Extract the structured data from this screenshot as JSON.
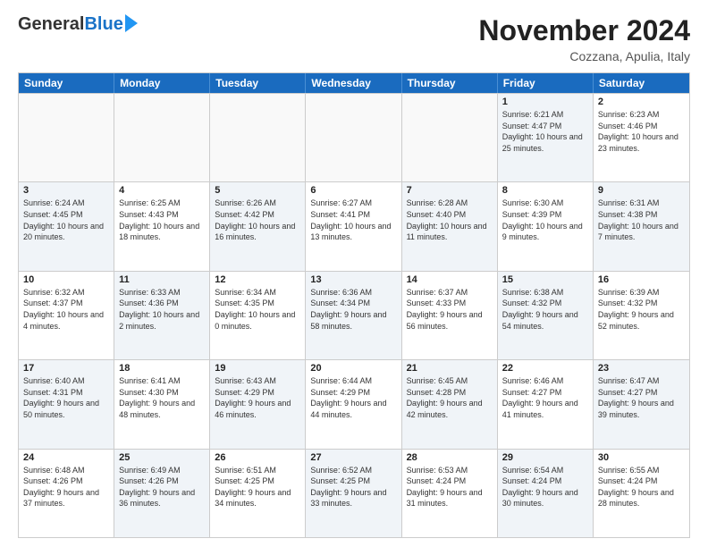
{
  "logo": {
    "general": "General",
    "blue": "Blue"
  },
  "title": "November 2024",
  "location": "Cozzana, Apulia, Italy",
  "weekdays": [
    "Sunday",
    "Monday",
    "Tuesday",
    "Wednesday",
    "Thursday",
    "Friday",
    "Saturday"
  ],
  "rows": [
    [
      {
        "day": "",
        "text": "",
        "empty": true
      },
      {
        "day": "",
        "text": "",
        "empty": true
      },
      {
        "day": "",
        "text": "",
        "empty": true
      },
      {
        "day": "",
        "text": "",
        "empty": true
      },
      {
        "day": "",
        "text": "",
        "empty": true
      },
      {
        "day": "1",
        "text": "Sunrise: 6:21 AM\nSunset: 4:47 PM\nDaylight: 10 hours and 25 minutes.",
        "shaded": true
      },
      {
        "day": "2",
        "text": "Sunrise: 6:23 AM\nSunset: 4:46 PM\nDaylight: 10 hours and 23 minutes.",
        "shaded": false
      }
    ],
    [
      {
        "day": "3",
        "text": "Sunrise: 6:24 AM\nSunset: 4:45 PM\nDaylight: 10 hours and 20 minutes.",
        "shaded": true
      },
      {
        "day": "4",
        "text": "Sunrise: 6:25 AM\nSunset: 4:43 PM\nDaylight: 10 hours and 18 minutes.",
        "shaded": false
      },
      {
        "day": "5",
        "text": "Sunrise: 6:26 AM\nSunset: 4:42 PM\nDaylight: 10 hours and 16 minutes.",
        "shaded": true
      },
      {
        "day": "6",
        "text": "Sunrise: 6:27 AM\nSunset: 4:41 PM\nDaylight: 10 hours and 13 minutes.",
        "shaded": false
      },
      {
        "day": "7",
        "text": "Sunrise: 6:28 AM\nSunset: 4:40 PM\nDaylight: 10 hours and 11 minutes.",
        "shaded": true
      },
      {
        "day": "8",
        "text": "Sunrise: 6:30 AM\nSunset: 4:39 PM\nDaylight: 10 hours and 9 minutes.",
        "shaded": false
      },
      {
        "day": "9",
        "text": "Sunrise: 6:31 AM\nSunset: 4:38 PM\nDaylight: 10 hours and 7 minutes.",
        "shaded": true
      }
    ],
    [
      {
        "day": "10",
        "text": "Sunrise: 6:32 AM\nSunset: 4:37 PM\nDaylight: 10 hours and 4 minutes.",
        "shaded": false
      },
      {
        "day": "11",
        "text": "Sunrise: 6:33 AM\nSunset: 4:36 PM\nDaylight: 10 hours and 2 minutes.",
        "shaded": true
      },
      {
        "day": "12",
        "text": "Sunrise: 6:34 AM\nSunset: 4:35 PM\nDaylight: 10 hours and 0 minutes.",
        "shaded": false
      },
      {
        "day": "13",
        "text": "Sunrise: 6:36 AM\nSunset: 4:34 PM\nDaylight: 9 hours and 58 minutes.",
        "shaded": true
      },
      {
        "day": "14",
        "text": "Sunrise: 6:37 AM\nSunset: 4:33 PM\nDaylight: 9 hours and 56 minutes.",
        "shaded": false
      },
      {
        "day": "15",
        "text": "Sunrise: 6:38 AM\nSunset: 4:32 PM\nDaylight: 9 hours and 54 minutes.",
        "shaded": true
      },
      {
        "day": "16",
        "text": "Sunrise: 6:39 AM\nSunset: 4:32 PM\nDaylight: 9 hours and 52 minutes.",
        "shaded": false
      }
    ],
    [
      {
        "day": "17",
        "text": "Sunrise: 6:40 AM\nSunset: 4:31 PM\nDaylight: 9 hours and 50 minutes.",
        "shaded": true
      },
      {
        "day": "18",
        "text": "Sunrise: 6:41 AM\nSunset: 4:30 PM\nDaylight: 9 hours and 48 minutes.",
        "shaded": false
      },
      {
        "day": "19",
        "text": "Sunrise: 6:43 AM\nSunset: 4:29 PM\nDaylight: 9 hours and 46 minutes.",
        "shaded": true
      },
      {
        "day": "20",
        "text": "Sunrise: 6:44 AM\nSunset: 4:29 PM\nDaylight: 9 hours and 44 minutes.",
        "shaded": false
      },
      {
        "day": "21",
        "text": "Sunrise: 6:45 AM\nSunset: 4:28 PM\nDaylight: 9 hours and 42 minutes.",
        "shaded": true
      },
      {
        "day": "22",
        "text": "Sunrise: 6:46 AM\nSunset: 4:27 PM\nDaylight: 9 hours and 41 minutes.",
        "shaded": false
      },
      {
        "day": "23",
        "text": "Sunrise: 6:47 AM\nSunset: 4:27 PM\nDaylight: 9 hours and 39 minutes.",
        "shaded": true
      }
    ],
    [
      {
        "day": "24",
        "text": "Sunrise: 6:48 AM\nSunset: 4:26 PM\nDaylight: 9 hours and 37 minutes.",
        "shaded": false
      },
      {
        "day": "25",
        "text": "Sunrise: 6:49 AM\nSunset: 4:26 PM\nDaylight: 9 hours and 36 minutes.",
        "shaded": true
      },
      {
        "day": "26",
        "text": "Sunrise: 6:51 AM\nSunset: 4:25 PM\nDaylight: 9 hours and 34 minutes.",
        "shaded": false
      },
      {
        "day": "27",
        "text": "Sunrise: 6:52 AM\nSunset: 4:25 PM\nDaylight: 9 hours and 33 minutes.",
        "shaded": true
      },
      {
        "day": "28",
        "text": "Sunrise: 6:53 AM\nSunset: 4:24 PM\nDaylight: 9 hours and 31 minutes.",
        "shaded": false
      },
      {
        "day": "29",
        "text": "Sunrise: 6:54 AM\nSunset: 4:24 PM\nDaylight: 9 hours and 30 minutes.",
        "shaded": true
      },
      {
        "day": "30",
        "text": "Sunrise: 6:55 AM\nSunset: 4:24 PM\nDaylight: 9 hours and 28 minutes.",
        "shaded": false
      }
    ]
  ]
}
